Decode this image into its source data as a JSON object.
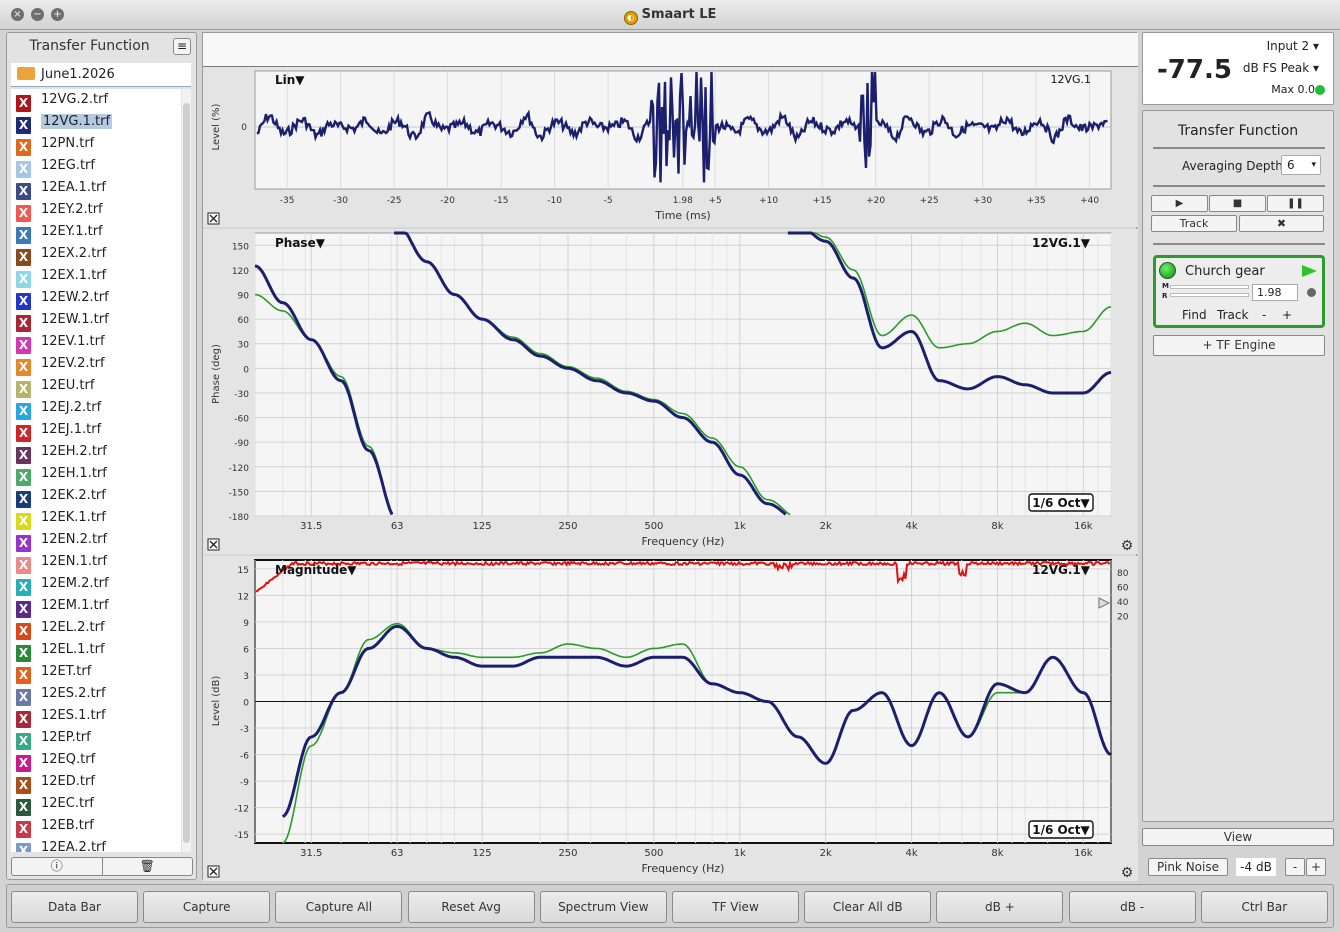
{
  "window": {
    "title": "Smaart LE"
  },
  "sidebar": {
    "title": "Transfer Function",
    "folder": "June1.2026",
    "files": [
      {
        "name": "12VG.2.trf",
        "color": "#b0141c"
      },
      {
        "name": "12VG.1.trf",
        "color": "#1e2a78",
        "selected": true
      },
      {
        "name": "12PN.trf",
        "color": "#e06a1c"
      },
      {
        "name": "12EG.trf",
        "color": "#a6c6e6"
      },
      {
        "name": "12EA.1.trf",
        "color": "#3c4a86"
      },
      {
        "name": "12EY.2.trf",
        "color": "#ef5a54"
      },
      {
        "name": "12EY.1.trf",
        "color": "#3d78b8"
      },
      {
        "name": "12EX.2.trf",
        "color": "#8a4a20"
      },
      {
        "name": "12EX.1.trf",
        "color": "#8fd6e6"
      },
      {
        "name": "12EW.2.trf",
        "color": "#2236c8"
      },
      {
        "name": "12EW.1.trf",
        "color": "#a62834"
      },
      {
        "name": "12EV.1.trf",
        "color": "#d437b0"
      },
      {
        "name": "12EV.2.trf",
        "color": "#e28a2a"
      },
      {
        "name": "12EU.trf",
        "color": "#b8b26a"
      },
      {
        "name": "12EJ.2.trf",
        "color": "#29a6e0"
      },
      {
        "name": "12EJ.1.trf",
        "color": "#d22424"
      },
      {
        "name": "12EH.2.trf",
        "color": "#6a3460"
      },
      {
        "name": "12EH.1.trf",
        "color": "#52a86a"
      },
      {
        "name": "12EK.2.trf",
        "color": "#1c3c78"
      },
      {
        "name": "12EK.1.trf",
        "color": "#dada1c"
      },
      {
        "name": "12EN.2.trf",
        "color": "#9a34c8"
      },
      {
        "name": "12EN.1.trf",
        "color": "#ec8a8a"
      },
      {
        "name": "12EM.2.trf",
        "color": "#26b0b6"
      },
      {
        "name": "12EM.1.trf",
        "color": "#5a2a8a"
      },
      {
        "name": "12EL.2.trf",
        "color": "#d84a1c"
      },
      {
        "name": "12EL.1.trf",
        "color": "#2a8a3a"
      },
      {
        "name": "12ET.trf",
        "color": "#e0601c"
      },
      {
        "name": "12ES.2.trf",
        "color": "#6a7aa8"
      },
      {
        "name": "12ES.1.trf",
        "color": "#a82a3a"
      },
      {
        "name": "12EP.trf",
        "color": "#3aa888"
      },
      {
        "name": "12EQ.trf",
        "color": "#c81c8a"
      },
      {
        "name": "12ED.trf",
        "color": "#a8501c"
      },
      {
        "name": "12EC.trf",
        "color": "#2a5a3a"
      },
      {
        "name": "12EB.trf",
        "color": "#c83a4a"
      },
      {
        "name": "12EA.2.trf",
        "color": "#7a9ac8"
      }
    ],
    "footer": {
      "info_icon": "info-icon",
      "trash_icon": "trash-icon"
    }
  },
  "impulse": {
    "mode_label": "Lin▼",
    "trace_label": "12VG.1",
    "y_label": "Level (%)",
    "x_label": "Time (ms)",
    "y_ticks": [
      "0"
    ],
    "x_ticks": [
      "-35",
      "-30",
      "-25",
      "-20",
      "-15",
      "-10",
      "-5",
      "1.98",
      "+5",
      "+10",
      "+15",
      "+20",
      "+25",
      "+30",
      "+35",
      "+40"
    ]
  },
  "phase": {
    "mode_label": "Phase▼",
    "trace_label": "12VG.1▼",
    "smoothing": "1/6 Oct▼",
    "y_label": "Phase (deg)",
    "x_label": "Frequency (Hz)",
    "y_ticks": [
      "150",
      "120",
      "90",
      "60",
      "30",
      "0",
      "-30",
      "-60",
      "-90",
      "-120",
      "-150",
      "-180"
    ],
    "x_ticks": [
      "31.5",
      "63",
      "125",
      "250",
      "500",
      "1k",
      "2k",
      "4k",
      "8k",
      "16k"
    ]
  },
  "magnitude": {
    "mode_label": "Magnitude▼",
    "trace_label": "12VG.1▼",
    "smoothing": "1/6 Oct▼",
    "y_label": "Level (dB)",
    "x_label": "Frequency (Hz)",
    "y_ticks": [
      "15",
      "12",
      "9",
      "6",
      "3",
      "0",
      "-3",
      "-6",
      "-9",
      "-12",
      "-15"
    ],
    "x_ticks": [
      "31.5",
      "63",
      "125",
      "250",
      "500",
      "1k",
      "2k",
      "4k",
      "8k",
      "16k"
    ],
    "coherence_ticks": [
      "80",
      "60",
      "40",
      "20"
    ]
  },
  "chart_data": [
    {
      "type": "line",
      "title": "Lin",
      "xlabel": "Time (ms)",
      "ylabel": "Level (%)",
      "series": [
        {
          "name": "12VG.1",
          "color": "#1b1f6e"
        }
      ],
      "peak_ms": 1.98,
      "xlim": [
        -38,
        42
      ]
    },
    {
      "type": "line",
      "title": "Phase",
      "xlabel": "Frequency (Hz)",
      "ylabel": "Phase (deg)",
      "ylim": [
        -180,
        165
      ],
      "x_log": true,
      "series": [
        {
          "name": "12VG.1",
          "color": "#1b1f6e",
          "x": [
            20,
            25,
            31.5,
            40,
            50,
            63,
            80,
            100,
            125,
            160,
            200,
            250,
            315,
            400,
            500,
            630,
            800,
            1000,
            1250,
            1600,
            2000,
            2500,
            3150,
            4000,
            5000,
            6300,
            8000,
            10000,
            12500,
            16000,
            20000
          ],
          "y": [
            125,
            80,
            35,
            -15,
            -100,
            175,
            130,
            90,
            60,
            35,
            15,
            0,
            -15,
            -30,
            -40,
            -60,
            -90,
            -130,
            -165,
            175,
            155,
            110,
            25,
            45,
            -15,
            -25,
            -10,
            -20,
            -30,
            -30,
            -5
          ]
        },
        {
          "name": "12VG.2",
          "color": "#2a9b2a",
          "x": [
            20,
            25,
            31.5,
            40,
            50,
            63,
            80,
            100,
            125,
            160,
            200,
            250,
            315,
            400,
            500,
            630,
            800,
            1000,
            1250,
            1600,
            2000,
            2500,
            3150,
            4000,
            5000,
            6300,
            8000,
            10000,
            12500,
            16000,
            20000
          ],
          "y": [
            90,
            70,
            35,
            -10,
            -95,
            175,
            130,
            90,
            60,
            38,
            18,
            2,
            -12,
            -28,
            -38,
            -55,
            -85,
            -120,
            -160,
            178,
            160,
            120,
            40,
            65,
            25,
            30,
            45,
            55,
            40,
            45,
            75
          ]
        }
      ]
    },
    {
      "type": "line",
      "title": "Magnitude",
      "xlabel": "Frequency (Hz)",
      "ylabel": "Level (dB)",
      "ylim": [
        -16,
        16
      ],
      "x_log": true,
      "series": [
        {
          "name": "12VG.1",
          "color": "#1b1f6e",
          "x": [
            25,
            31.5,
            40,
            50,
            63,
            80,
            100,
            125,
            160,
            200,
            250,
            315,
            400,
            500,
            630,
            800,
            1000,
            1250,
            1600,
            2000,
            2500,
            3150,
            4000,
            5000,
            6300,
            8000,
            10000,
            12500,
            16000,
            20000
          ],
          "y": [
            -13,
            -4,
            1,
            6,
            8.5,
            6,
            5,
            4,
            4,
            5,
            5,
            5,
            4,
            5,
            5,
            2,
            1,
            0,
            -4,
            -7,
            -1,
            1,
            -5,
            1,
            -4,
            2,
            1,
            5,
            1,
            -6
          ]
        },
        {
          "name": "12VG.2",
          "color": "#2a9b2a",
          "x": [
            25,
            31.5,
            40,
            50,
            63,
            80,
            100,
            125,
            160,
            200,
            250,
            315,
            400,
            500,
            630,
            800,
            1000,
            1250,
            1600,
            2000,
            2500,
            3150,
            4000,
            5000,
            6300,
            8000,
            10000,
            12500,
            16000,
            20000
          ],
          "y": [
            -16,
            -5,
            1,
            7,
            8.8,
            6,
            5.5,
            5,
            5,
            5.5,
            6.5,
            6,
            5,
            6,
            6.5,
            2,
            1,
            0,
            -4,
            -7,
            -1,
            1,
            -5,
            1,
            -4,
            1,
            1,
            5,
            1,
            -6
          ]
        }
      ]
    }
  ],
  "meter": {
    "value": "-77.5",
    "input": "Input 2",
    "unit": "dB FS Peak",
    "max": "Max 0.0"
  },
  "tf_panel": {
    "title": "Transfer Function",
    "avg_label": "Averaging Depth:",
    "avg_value": "6",
    "track_label": "Track",
    "engine": {
      "name": "Church gear",
      "delay": "1.98",
      "find": "Find",
      "track": "Track",
      "minus": "-",
      "plus": "+",
      "m": "M",
      "r": "R"
    },
    "add_engine": "+ TF Engine"
  },
  "bottom_right": {
    "view": "View",
    "pink_noise": "Pink Noise",
    "noise_level": "-4 dB",
    "minus": "-",
    "plus": "+"
  },
  "toolbar": [
    "Data Bar",
    "Capture",
    "Capture All",
    "Reset Avg",
    "Spectrum View",
    "TF View",
    "Clear All dB",
    "dB +",
    "dB -",
    "Ctrl Bar"
  ]
}
